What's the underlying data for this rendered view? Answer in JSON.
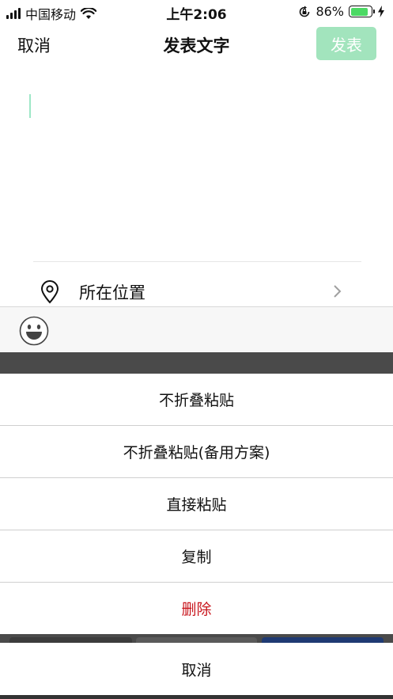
{
  "status_bar": {
    "carrier": "中国移动",
    "time": "上午2:06",
    "battery_percent": "86%",
    "battery_level": 0.86
  },
  "nav": {
    "cancel_label": "取消",
    "title": "发表文字",
    "publish_label": "发表"
  },
  "location": {
    "label": "所在位置"
  },
  "action_sheet": {
    "items": [
      {
        "label": "不折叠粘贴"
      },
      {
        "label": "不折叠粘贴(备用方案)"
      },
      {
        "label": "直接粘贴"
      },
      {
        "label": "复制"
      },
      {
        "label": "删除"
      }
    ],
    "cancel_label": "取消"
  },
  "colors": {
    "publish_disabled": "#a2e4bd",
    "danger": "#c8161d",
    "caret": "#9ee7c7",
    "battery": "#4cd964"
  },
  "icons": [
    "signal-icon",
    "wifi-icon",
    "rotation-lock-icon",
    "battery-icon",
    "charging-icon",
    "location-pin-icon",
    "chevron-right-icon",
    "emoji-icon"
  ]
}
